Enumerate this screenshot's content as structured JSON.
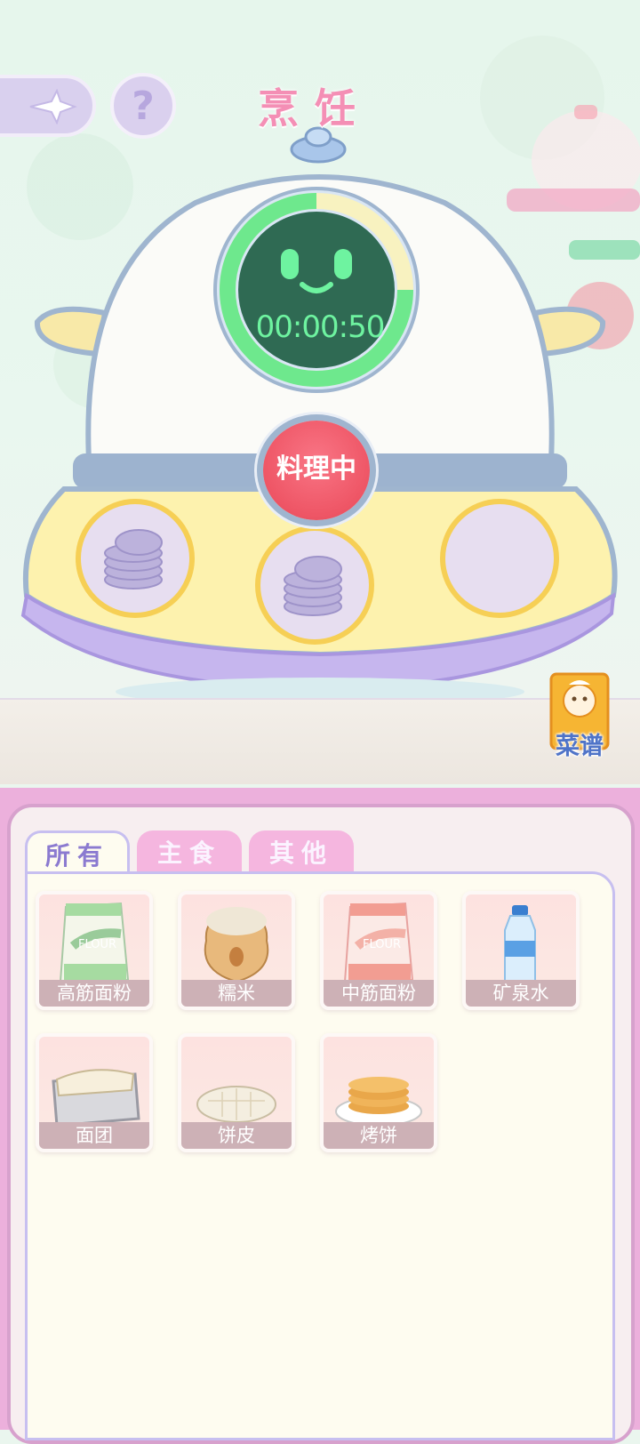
{
  "screen": {
    "title": "烹饪",
    "help_label": "?",
    "timer": "00:00:50",
    "cook_button": "料理中",
    "recipe_button": "菜谱"
  },
  "slots": [
    {
      "state": "filled",
      "icon": "stacked-discs-icon"
    },
    {
      "state": "filled",
      "icon": "stacked-discs-icon"
    },
    {
      "state": "empty"
    }
  ],
  "timer_progress": 0.75,
  "tabs": [
    {
      "label": "所有",
      "active": true
    },
    {
      "label": "主食",
      "active": false
    },
    {
      "label": "其他",
      "active": false
    }
  ],
  "items": [
    {
      "name": "高筋面粉",
      "icon": "flour-bag-green-icon"
    },
    {
      "name": "糯米",
      "icon": "rice-sack-icon"
    },
    {
      "name": "中筋面粉",
      "icon": "flour-bag-pink-icon"
    },
    {
      "name": "矿泉水",
      "icon": "water-bottle-icon"
    },
    {
      "name": "面团",
      "icon": "dough-tray-icon"
    },
    {
      "name": "饼皮",
      "icon": "pie-crust-icon"
    },
    {
      "name": "烤饼",
      "icon": "pancake-stack-icon"
    }
  ],
  "colors": {
    "accent_pink": "#f48fb5",
    "panel_pink": "#ecb0dc",
    "timer_green": "#6ef3a0",
    "cook_red": "#ee5565"
  }
}
